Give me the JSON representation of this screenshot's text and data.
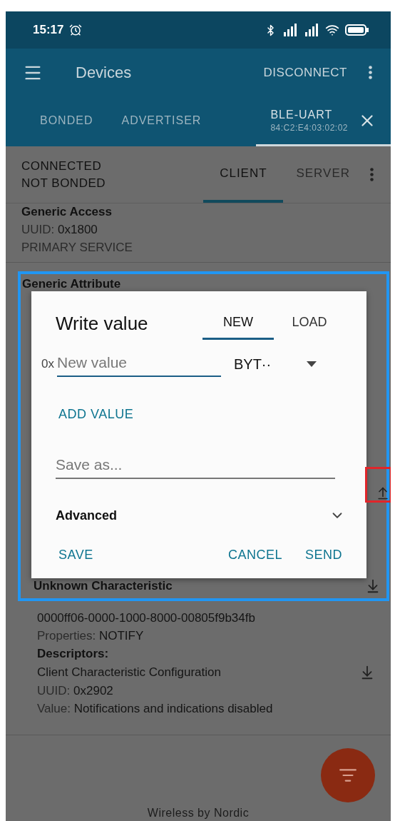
{
  "status_bar": {
    "time": "15:17"
  },
  "app_bar": {
    "title": "Devices",
    "action": "DISCONNECT"
  },
  "device_tabs": [
    {
      "label": "BONDED",
      "selected": false
    },
    {
      "label": "ADVERTISER",
      "selected": false
    },
    {
      "label": "BLE-UART",
      "subtitle": "84:C2:E4:03:02:02",
      "selected": true
    }
  ],
  "connection": {
    "status": "CONNECTED",
    "bond_state": "NOT BONDED",
    "tabs": [
      {
        "label": "CLIENT",
        "selected": true
      },
      {
        "label": "SERVER",
        "selected": false
      }
    ]
  },
  "services": [
    {
      "name": "Generic Access",
      "uuid_label": "UUID:",
      "uuid": "0x1800",
      "type": "PRIMARY SERVICE"
    },
    {
      "name": "Generic Attribute"
    }
  ],
  "dialog": {
    "title": "Write value",
    "tabs": [
      {
        "label": "NEW",
        "selected": true
      },
      {
        "label": "LOAD",
        "selected": false
      }
    ],
    "prefix": "0x",
    "value_placeholder": "New value",
    "format": "BYT··",
    "add_value": "ADD VALUE",
    "save_placeholder": "Save as...",
    "advanced": "Advanced",
    "expanded": false,
    "buttons": [
      {
        "label": "SAVE",
        "kind": "left"
      },
      {
        "label": "CANCEL",
        "kind": "right"
      },
      {
        "label": "SEND",
        "kind": "right"
      }
    ]
  },
  "characteristic": {
    "name": "Unknown Characteristic",
    "uuid": "0000ff06-0000-1000-8000-00805f9b34fb",
    "properties_label": "Properties:",
    "properties": "NOTIFY",
    "descriptors_label": "Descriptors:",
    "descriptor": {
      "name": "Client Characteristic Configuration",
      "uuid_label": "UUID:",
      "uuid": "0x2902",
      "value_label": "Value:",
      "value": "Notifications and indications disabled"
    }
  },
  "footer": "Wireless by Nordic"
}
